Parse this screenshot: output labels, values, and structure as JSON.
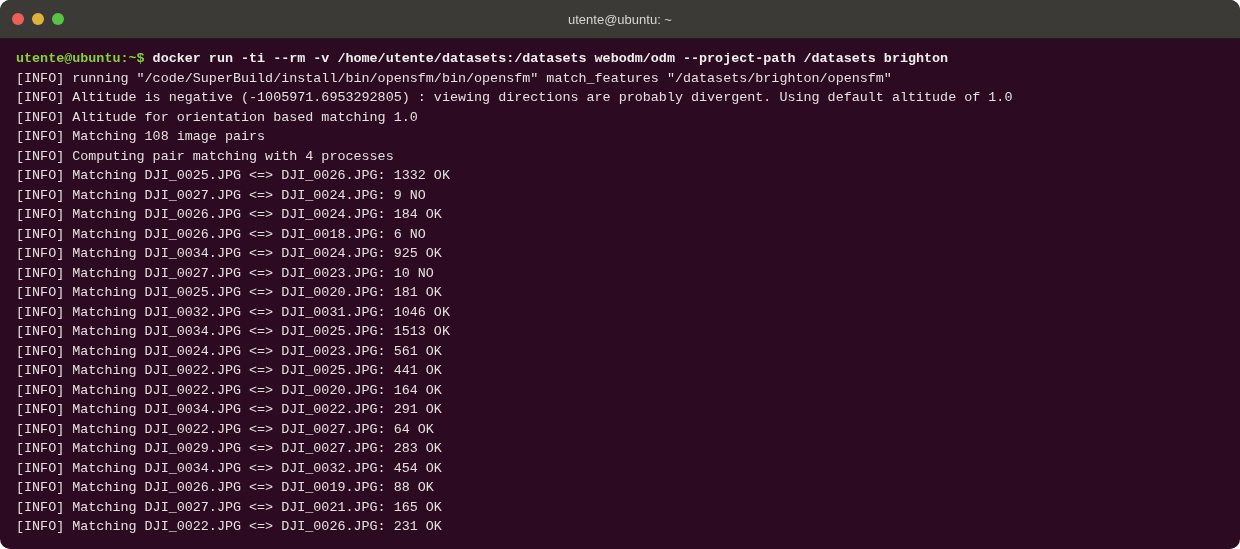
{
  "window": {
    "title": "utente@ubuntu: ~"
  },
  "terminal": {
    "prompt": {
      "user_host": "utente@ubuntu:~$",
      "command": "docker run -ti --rm -v /home/utente/datasets:/datasets webodm/odm --project-path /datasets brighton"
    },
    "lines": [
      "[INFO] running \"/code/SuperBuild/install/bin/opensfm/bin/opensfm\" match_features \"/datasets/brighton/opensfm\"",
      "[INFO] Altitude is negative (-1005971.6953292805) : viewing directions are probably divergent. Using default altitude of 1.0",
      "[INFO] Altitude for orientation based matching 1.0",
      "[INFO] Matching 108 image pairs",
      "[INFO] Computing pair matching with 4 processes",
      "[INFO] Matching DJI_0025.JPG <=> DJI_0026.JPG: 1332 OK",
      "[INFO] Matching DJI_0027.JPG <=> DJI_0024.JPG: 9 NO",
      "[INFO] Matching DJI_0026.JPG <=> DJI_0024.JPG: 184 OK",
      "[INFO] Matching DJI_0026.JPG <=> DJI_0018.JPG: 6 NO",
      "[INFO] Matching DJI_0034.JPG <=> DJI_0024.JPG: 925 OK",
      "[INFO] Matching DJI_0027.JPG <=> DJI_0023.JPG: 10 NO",
      "[INFO] Matching DJI_0025.JPG <=> DJI_0020.JPG: 181 OK",
      "[INFO] Matching DJI_0032.JPG <=> DJI_0031.JPG: 1046 OK",
      "[INFO] Matching DJI_0034.JPG <=> DJI_0025.JPG: 1513 OK",
      "[INFO] Matching DJI_0024.JPG <=> DJI_0023.JPG: 561 OK",
      "[INFO] Matching DJI_0022.JPG <=> DJI_0025.JPG: 441 OK",
      "[INFO] Matching DJI_0022.JPG <=> DJI_0020.JPG: 164 OK",
      "[INFO] Matching DJI_0034.JPG <=> DJI_0022.JPG: 291 OK",
      "[INFO] Matching DJI_0022.JPG <=> DJI_0027.JPG: 64 OK",
      "[INFO] Matching DJI_0029.JPG <=> DJI_0027.JPG: 283 OK",
      "[INFO] Matching DJI_0034.JPG <=> DJI_0032.JPG: 454 OK",
      "[INFO] Matching DJI_0026.JPG <=> DJI_0019.JPG: 88 OK",
      "[INFO] Matching DJI_0027.JPG <=> DJI_0021.JPG: 165 OK",
      "[INFO] Matching DJI_0022.JPG <=> DJI_0026.JPG: 231 OK"
    ]
  }
}
